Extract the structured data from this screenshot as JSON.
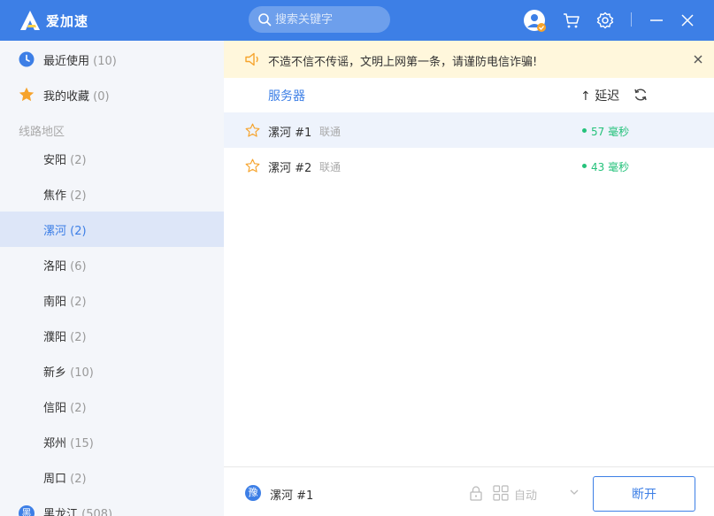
{
  "app": {
    "title": "爱加速"
  },
  "search": {
    "placeholder": "搜索关键字"
  },
  "sidebar": {
    "recent": {
      "label": "最近使用",
      "count": "(10)"
    },
    "favorites": {
      "label": "我的收藏",
      "count": "(0)"
    },
    "section_title": "线路地区",
    "regions": [
      {
        "label": "安阳",
        "count": "(2)"
      },
      {
        "label": "焦作",
        "count": "(2)"
      },
      {
        "label": "漯河",
        "count": "(2)"
      },
      {
        "label": "洛阳",
        "count": "(6)"
      },
      {
        "label": "南阳",
        "count": "(2)"
      },
      {
        "label": "濮阳",
        "count": "(2)"
      },
      {
        "label": "新乡",
        "count": "(10)"
      },
      {
        "label": "信阳",
        "count": "(2)"
      },
      {
        "label": "郑州",
        "count": "(15)"
      },
      {
        "label": "周口",
        "count": "(2)"
      }
    ],
    "next_province": {
      "badge": "黑",
      "label": "黑龙江",
      "count": "(508)"
    }
  },
  "notice": {
    "text": "不造不信不传谣，文明上网第一条，请谨防电信诈骗!"
  },
  "table": {
    "col_server": "服务器",
    "col_latency": "延迟",
    "rows": [
      {
        "name": "漯河 #1",
        "isp": "联通",
        "latency": "57 毫秒"
      },
      {
        "name": "漯河 #2",
        "isp": "联通",
        "latency": "43 毫秒"
      }
    ]
  },
  "bottom": {
    "province_badge": "豫",
    "current_server": "漯河 #1",
    "mode": "自动",
    "disconnect_label": "断开"
  },
  "colors": {
    "accent": "#3d7fe6",
    "latency_good": "#25c27b",
    "notice_bg": "#fff7dc",
    "favorite": "#f6a32b"
  }
}
